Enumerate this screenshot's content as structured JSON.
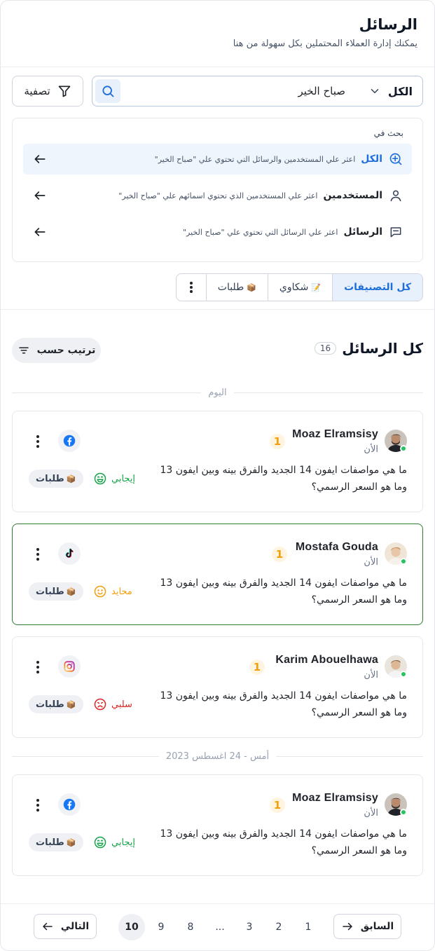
{
  "header": {
    "title": "الرسائل",
    "subtitle": "يمكنك إدارة العملاء المحتملين بكل سهولة من هنا"
  },
  "search": {
    "scope_value": "الكل",
    "query": "صباح الخير",
    "filter_label": "تصفية",
    "scopes_heading": "بحث في",
    "scopes": [
      {
        "label": "الكل",
        "desc": "اعثر علي المستخدمين والرسائل التي تحتوي علي \"صباح الخير\"",
        "icon": "search-plus-icon"
      },
      {
        "label": "المستخدمين",
        "desc": "اعثر علي المستخدمين الذي تحتوي اسمائهم علي \"صباح الخير\"",
        "icon": "user-icon"
      },
      {
        "label": "الرسائل",
        "desc": "اعثر علي الرسائل التي تحتوي علي \"صباح الخير\"",
        "icon": "chat-icon"
      }
    ]
  },
  "tabs": [
    {
      "label": "كل التصنيفات",
      "emoji": ""
    },
    {
      "label": "شكاوي",
      "emoji": "📝"
    },
    {
      "label": "طلبات",
      "emoji": "📦"
    }
  ],
  "list": {
    "title": "كل الرسائل",
    "count": "16",
    "sort_label": "ترتيب حسب"
  },
  "date_groups": {
    "today": "اليوم",
    "yesterday": "أمس - 24 اغسطس 2023"
  },
  "messages": [
    {
      "sender": "Moaz Elramsisy",
      "unread": "1",
      "time": "الأن",
      "text": "ما هي مواصفات ايفون 14 الجديد والفرق بينه وبين ايفون 13 وما هو السعر الرسمي؟",
      "sentiment": "إيجابي",
      "tag": "طلبات",
      "tag_emoji": "📦",
      "channel": "facebook-icon"
    },
    {
      "sender": "Mostafa Gouda",
      "unread": "1",
      "time": "الأن",
      "text": "ما هي مواصفات ايفون 14 الجديد والفرق بينه وبين ايفون 13 وما هو السعر الرسمي؟",
      "sentiment": "محايد",
      "tag": "طلبات",
      "tag_emoji": "📦",
      "channel": "tiktok-icon"
    },
    {
      "sender": "Karim Abouelhawa",
      "unread": "1",
      "time": "الأن",
      "text": "ما هي مواصفات ايفون 14 الجديد والفرق بينه وبين ايفون 13 وما هو السعر الرسمي؟",
      "sentiment": "سلبي",
      "tag": "طلبات",
      "tag_emoji": "📦",
      "channel": "instagram-icon"
    },
    {
      "sender": "Moaz Elramsisy",
      "unread": "1",
      "time": "الأن",
      "text": "ما هي مواصفات ايفون 14 الجديد والفرق بينه وبين ايفون 13 وما هو السعر الرسمي؟",
      "sentiment": "إيجابي",
      "tag": "طلبات",
      "tag_emoji": "📦",
      "channel": "facebook-icon"
    }
  ],
  "pagination": {
    "prev_label": "السابق",
    "next_label": "التالي",
    "pages": [
      "1",
      "2",
      "3",
      "...",
      "8",
      "9",
      "10"
    ],
    "current": "10"
  },
  "colors": {
    "primary": "#1e6fd9",
    "positive": "#16a34a",
    "neutral": "#f59e0b",
    "negative": "#dc2626",
    "selected_border": "#2e7d32",
    "online": "#22c55e"
  }
}
